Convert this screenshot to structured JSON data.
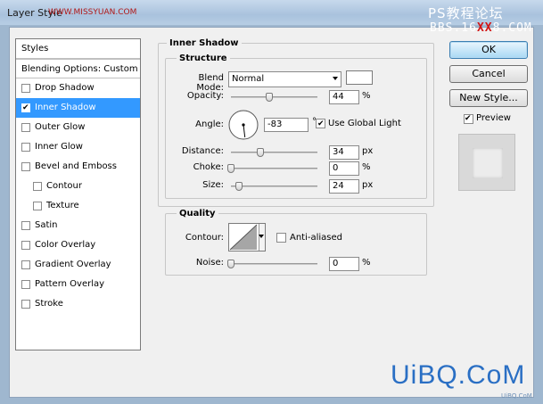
{
  "window": {
    "title": "Layer Style",
    "site_watermark": "WWW.MISSYUAN.COM",
    "watermark_line1": "PS教程论坛",
    "watermark_line2_prefix": "BBS.16",
    "watermark_line2_highlight": "XX",
    "watermark_line2_suffix": "8.COM"
  },
  "style_list": {
    "header": "Styles",
    "blending_options": "Blending Options: Custom",
    "items": [
      {
        "label": "Drop Shadow",
        "checked": false,
        "indent": false
      },
      {
        "label": "Inner Shadow",
        "checked": true,
        "indent": false,
        "selected": true
      },
      {
        "label": "Outer Glow",
        "checked": false,
        "indent": false
      },
      {
        "label": "Inner Glow",
        "checked": false,
        "indent": false
      },
      {
        "label": "Bevel and Emboss",
        "checked": false,
        "indent": false
      },
      {
        "label": "Contour",
        "checked": false,
        "indent": true
      },
      {
        "label": "Texture",
        "checked": false,
        "indent": true
      },
      {
        "label": "Satin",
        "checked": false,
        "indent": false
      },
      {
        "label": "Color Overlay",
        "checked": false,
        "indent": false
      },
      {
        "label": "Gradient Overlay",
        "checked": false,
        "indent": false
      },
      {
        "label": "Pattern Overlay",
        "checked": false,
        "indent": false
      },
      {
        "label": "Stroke",
        "checked": false,
        "indent": false
      }
    ]
  },
  "buttons": {
    "ok": "OK",
    "cancel": "Cancel",
    "new_style": "New Style...",
    "preview_label": "Preview",
    "preview_checked": true
  },
  "inner_shadow": {
    "title": "Inner Shadow",
    "structure": {
      "title": "Structure",
      "blend_mode_label": "Blend Mode:",
      "blend_mode_value": "Normal",
      "blend_color": "#ffffff",
      "opacity_label": "Opacity:",
      "opacity_value": "44",
      "opacity_unit": "%",
      "opacity_level": 44,
      "angle_label": "Angle:",
      "angle_value": "-83",
      "angle_unit": "°",
      "angle_degrees": -83,
      "use_global_light_label": "Use Global Light",
      "use_global_light_checked": true,
      "distance_label": "Distance:",
      "distance_value": "34",
      "distance_unit": "px",
      "distance_level": 34,
      "choke_label": "Choke:",
      "choke_value": "0",
      "choke_unit": "%",
      "choke_level": 0,
      "size_label": "Size:",
      "size_value": "24",
      "size_unit": "px",
      "size_level": 24
    },
    "quality": {
      "title": "Quality",
      "contour_label": "Contour:",
      "anti_aliased_label": "Anti-aliased",
      "anti_aliased_checked": false,
      "noise_label": "Noise:",
      "noise_value": "0",
      "noise_unit": "%",
      "noise_level": 0
    }
  },
  "logo": {
    "text": "UiBQ.CoM",
    "sub": "UiBQ.CoM"
  },
  "colors": {
    "selection": "#3399ff",
    "ok_button": "#a8d8f4",
    "logo": "#2a6fc4"
  }
}
